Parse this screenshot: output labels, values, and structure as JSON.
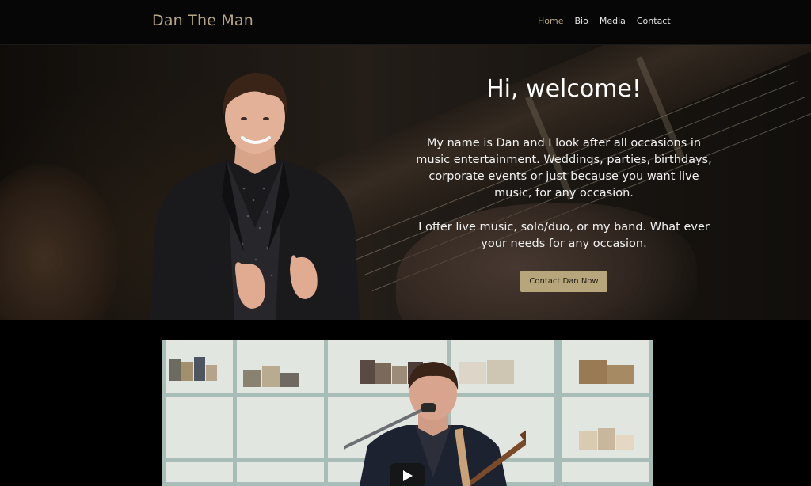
{
  "site": {
    "title": "Dan The Man"
  },
  "nav": {
    "items": [
      {
        "label": "Home",
        "active": true
      },
      {
        "label": "Bio",
        "active": false
      },
      {
        "label": "Media",
        "active": false
      },
      {
        "label": "Contact",
        "active": false
      }
    ]
  },
  "hero": {
    "heading": "Hi, welcome!",
    "paragraph1": "My name is Dan and I look after all occasions in music entertainment. Weddings, parties, birthdays, corporate events or just because you want live music, for any occasion.",
    "paragraph2": "I offer live music, solo/duo, or my band. What ever your needs for any occasion.",
    "cta_label": "Contact Dan Now"
  },
  "colors": {
    "accent": "#b7a684",
    "button": "#b7a67c",
    "background": "#000000"
  },
  "video": {
    "play_icon": "play-icon"
  }
}
